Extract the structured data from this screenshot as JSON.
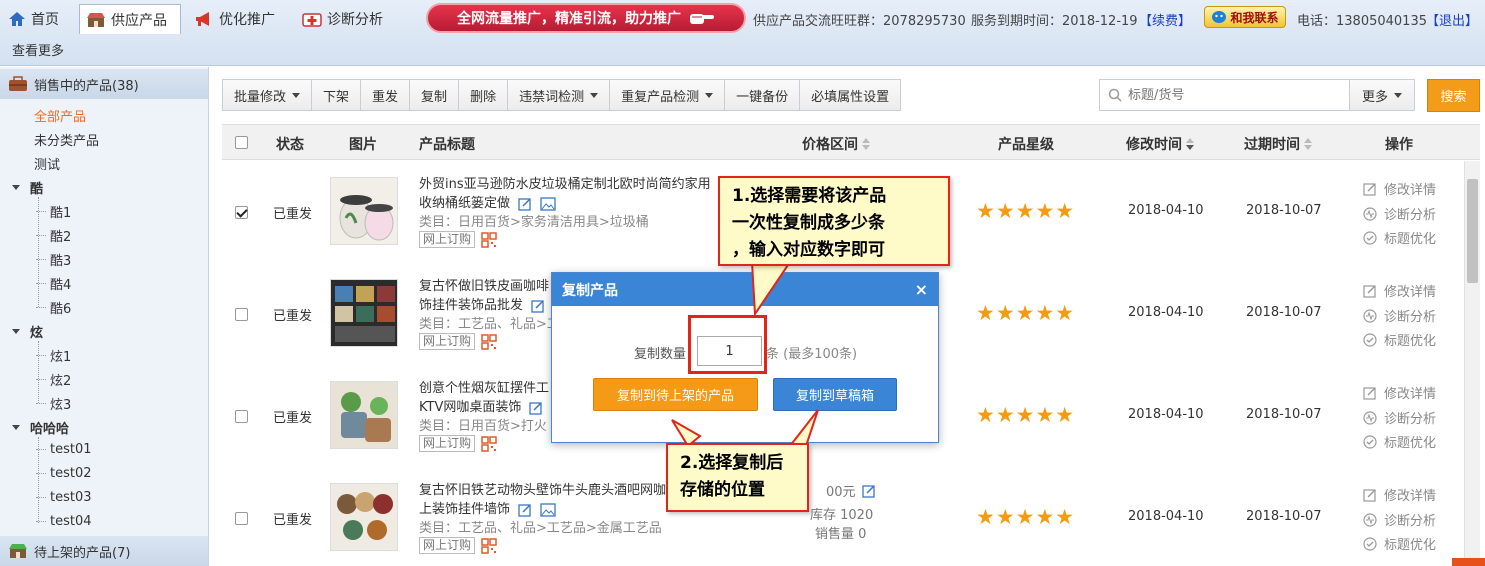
{
  "topbar": {
    "nav": [
      {
        "label": "首页",
        "icon": "home-icon"
      },
      {
        "label": "供应产品",
        "icon": "store-icon"
      },
      {
        "label": "优化推广",
        "icon": "megaphone-icon"
      },
      {
        "label": "诊断分析",
        "icon": "medical-kit-icon"
      }
    ],
    "promo": "全网流量推广，精准引流，助力推广",
    "group_info": "供应产品交流旺旺群：2078295730",
    "expire_info": "服务到期时间：2018-12-19",
    "renew": "【续费】",
    "contact": "和我联系",
    "phone": "电话：13805040135",
    "logout": "【退出】",
    "more": "查看更多"
  },
  "sidebar": {
    "on_sale": "销售中的产品(38)",
    "all": "全部产品",
    "uncategorized": "未分类产品",
    "test": "测试",
    "groups": [
      {
        "label": "酷",
        "children": [
          "酷1",
          "酷2",
          "酷3",
          "酷4",
          "酷6"
        ]
      },
      {
        "label": "炫",
        "children": [
          "炫1",
          "炫2",
          "炫3"
        ]
      },
      {
        "label": "哈哈哈",
        "children": [
          "test01",
          "test02",
          "test03",
          "test04"
        ]
      }
    ],
    "pending": "待上架的产品(7)"
  },
  "toolbar": {
    "batch_edit": "批量修改",
    "unlist": "下架",
    "republish": "重发",
    "copy": "复制",
    "delete": "删除",
    "banned_check": "违禁词检测",
    "duplicate_check": "重复产品检测",
    "backup": "一键备份",
    "required_attrs": "必填属性设置",
    "search_placeholder": "标题/货号",
    "more": "更多",
    "search": "搜索"
  },
  "table": {
    "headers": {
      "status": "状态",
      "image": "图片",
      "title": "产品标题",
      "price": "价格区间",
      "rating": "产品星级",
      "modified": "修改时间",
      "expires": "过期时间",
      "actions": "操作"
    },
    "actions": [
      "修改详情",
      "诊断分析",
      "标题优化"
    ],
    "order_badge": "网上订购",
    "stars": "★★★★★",
    "rows": [
      {
        "checked": true,
        "status": "已重发",
        "title1": "外贸ins亚马逊防水皮垃圾桶定制北欧时尚简约家用",
        "title2": "收纳桶纸篓定做",
        "category": "类目：日用百货>家务清洁用具>垃圾桶",
        "modified": "2018-04-10",
        "expires": "2018-10-07"
      },
      {
        "checked": false,
        "status": "已重发",
        "title1": "复古怀做旧铁皮画咖啡",
        "title2": "饰挂件装饰品批发",
        "category": "类目：工艺品、礼品>工",
        "modified": "2018-04-10",
        "expires": "2018-10-07"
      },
      {
        "checked": false,
        "status": "已重发",
        "title1": "创意个性烟灰缸摆件工",
        "title2": "KTV网咖桌面装饰",
        "category": "类目：日用百货>打火",
        "modified": "2018-04-10",
        "expires": "2018-10-07"
      },
      {
        "checked": false,
        "status": "已重发",
        "title1": "复古怀旧铁艺动物头壁饰牛头鹿头酒吧网咖",
        "title2": "上装饰挂件墙饰",
        "category": "类目：工艺品、礼品>工艺品>金属工艺品",
        "price": "00元",
        "stock": "库存 1020",
        "sales": "销售量 0",
        "modified": "2018-04-10",
        "expires": "2018-10-07"
      }
    ]
  },
  "dialog": {
    "title": "复制产品",
    "close": "×",
    "qty_label": "复制数量",
    "qty_value": "1",
    "qty_unit": "条 (最多100条)",
    "btn_pending": "复制到待上架的产品",
    "btn_draft": "复制到草稿箱"
  },
  "annotations": {
    "step1": [
      "1.选择需要将该产品",
      "一次性复制成多少条",
      "，输入对应数字即可"
    ],
    "step2": [
      "2.选择复制后",
      "存储的位置"
    ]
  },
  "colors": {
    "accent_orange": "#f39c1a",
    "dialog_blue": "#3a85d6",
    "annotation_red": "#e42418",
    "star": "#f39c12"
  }
}
